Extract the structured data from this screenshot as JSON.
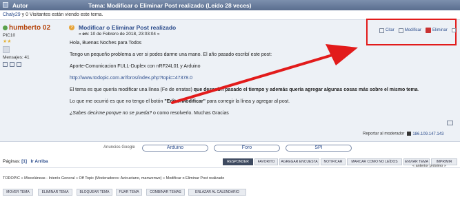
{
  "header": {
    "author_label": "Autor",
    "topic_title": "Tema: Modificar o Eliminar Post realizado  (Leído 28 veces)"
  },
  "viewers": {
    "user": "Chaly29",
    "text": " y 0 Visitantes están viendo este tema."
  },
  "poster": {
    "name": "humberto 02",
    "rank": "PIC10",
    "stars": "★★",
    "messages": "Mensajes: 41"
  },
  "post": {
    "subject": "Modificar o Eliminar Post realizado",
    "date_prefix": "« ",
    "date_on": "en:",
    "date": " 10 de Febrero de 2018, 23:03:04 »",
    "tools": {
      "quote": "Citar",
      "modify": "Modificar",
      "delete": "Eliminar"
    },
    "body": {
      "p1": "Hola, Buenas Noches para Todos",
      "p2": "Tengo un pequeño problema a ver si podes darme una mano. El año pasado escribí este post:",
      "p3": "Aporte-Comunicacion FULL-Duplex con nRF24L01 y Arduino",
      "p4_link": "http://www.todopic.com.ar/foros/index.php?topic=47378.0",
      "p5_a": "El tema es que quería modificar una línea (Fe de erratas) ",
      "p5_b": "que descubrí pasado el tiempo y además quería agregar algunas cosas más sobre el mismo tema",
      "p5_c": ".",
      "p6_a": "Lo que me ocurrió es que no tengo el botón ",
      "p6_b": "\"Editar/Modificar\"",
      "p6_c": " para corregir la línea y agregar al post.",
      "p7_a": "¿Sabes decirme porque no se pueda?",
      "p7_b": " o como resolverlo. Muchas Gracias"
    },
    "report": "Reportar al moderador",
    "ip": "186.109.147.143"
  },
  "ads": {
    "google": "Anuncios Google",
    "buttons": [
      "Arduino",
      "Foro",
      "SPI"
    ]
  },
  "pagination": {
    "label": "Páginas: ",
    "current": "[1]",
    "top": "Ir Arriba",
    "prev_next": "« anterior próximo »"
  },
  "actions": [
    "RESPONDER",
    "FAVORITO",
    "AGREGAR ENCUESTA",
    "NOTIFICAR",
    "MARCAR COMO NO LEÍDOS",
    "ENVIAR TEMA",
    "IMPRIMIR"
  ],
  "breadcrumb": "TODOPIC » Misceláneas - Interés General » Off Topic (Moderadores: Azicuetano, manwenwe) » Modificar o Eliminar Post realizado",
  "mod_actions": [
    "MOVER TEMA",
    "ELIMINAR TEMA",
    "BLOQUEAR TEMA",
    "FIJAR TEMA",
    "COMBINAR TEMAS",
    "ENLAZAR AL CALENDARIO"
  ]
}
